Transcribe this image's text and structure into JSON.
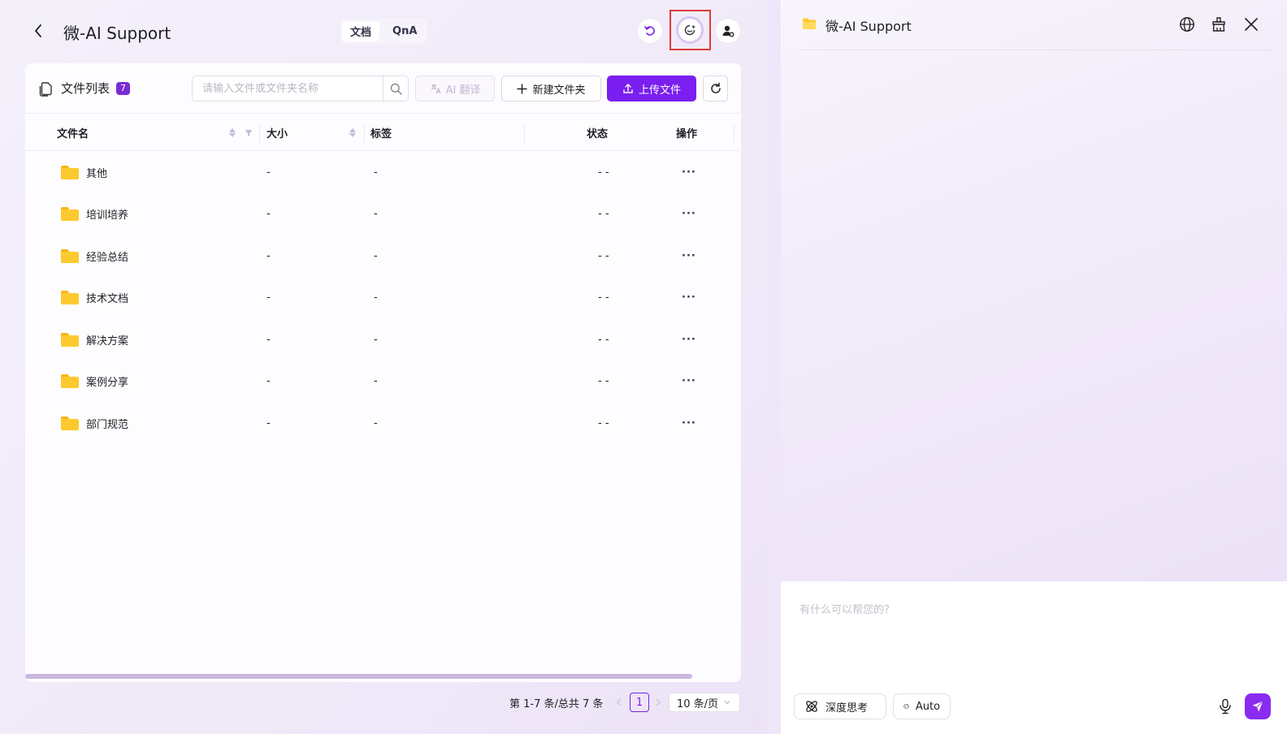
{
  "header": {
    "title": "微-AI Support",
    "tabs": [
      {
        "label": "文档",
        "active": true
      },
      {
        "label": "QnA",
        "active": false
      }
    ]
  },
  "toolbar": {
    "list_title": "文件列表",
    "count": "7",
    "search_placeholder": "请输入文件或文件夹名称",
    "ai_translate_label": "AI 翻译",
    "new_folder_label": "新建文件夹",
    "upload_label": "上传文件"
  },
  "table": {
    "columns": {
      "name": "文件名",
      "size": "大小",
      "tags": "标签",
      "status": "状态",
      "actions": "操作"
    },
    "rows": [
      {
        "name": "其他",
        "size": "-",
        "tags": "-",
        "status": "- -",
        "actions": "···"
      },
      {
        "name": "培训培养",
        "size": "-",
        "tags": "-",
        "status": "- -",
        "actions": "···"
      },
      {
        "name": "经验总结",
        "size": "-",
        "tags": "-",
        "status": "- -",
        "actions": "···"
      },
      {
        "name": "技术文档",
        "size": "-",
        "tags": "-",
        "status": "- -",
        "actions": "···"
      },
      {
        "name": "解决方案",
        "size": "-",
        "tags": "-",
        "status": "- -",
        "actions": "···"
      },
      {
        "name": "案例分享",
        "size": "-",
        "tags": "-",
        "status": "- -",
        "actions": "···"
      },
      {
        "name": "部门规范",
        "size": "-",
        "tags": "-",
        "status": "- -",
        "actions": "···"
      }
    ]
  },
  "pagination": {
    "summary": "第 1-7 条/总共 7 条",
    "current_page": "1",
    "page_size": "10 条/页"
  },
  "chat": {
    "title": "微-AI Support",
    "input_placeholder": "有什么可以帮您的?",
    "deep_think_label": "深度思考",
    "auto_label": "Auto"
  },
  "colors": {
    "accent": "#7a1ff0",
    "highlight_box": "#e03a3a",
    "folder": "#fcca2e"
  }
}
